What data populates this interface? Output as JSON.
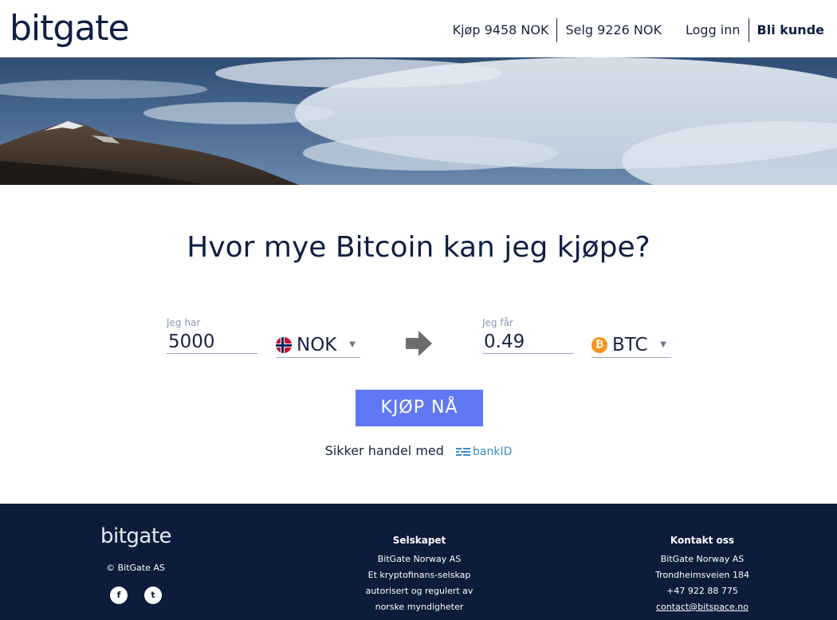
{
  "header": {
    "logo": "bitgate",
    "buy_price": "Kjøp 9458 NOK",
    "sell_price": "Selg 9226 NOK",
    "login": "Logg inn",
    "signup": "Bli kunde"
  },
  "main": {
    "title": "Hvor mye Bitcoin kan jeg kjøpe?",
    "have": {
      "label": "Jeg har",
      "value": "5000",
      "currency": "NOK"
    },
    "get": {
      "label": "Jeg får",
      "value": "0.49",
      "currency": "BTC"
    },
    "buy_button": "KJØP NÅ",
    "secure_text": "Sikker handel med",
    "bankid": "bankID"
  },
  "footer": {
    "logo": "bitgate",
    "copyright": "© BitGate AS",
    "company": {
      "heading": "Selskapet",
      "lines": [
        "BitGate Norway AS",
        "Et kryptofinans-selskap",
        "autorisert og regulert av",
        "norske myndigheter"
      ]
    },
    "contact": {
      "heading": "Kontakt oss",
      "lines": [
        "BitGate Norway AS",
        "Trondheimsveien 184",
        "+47 922 88 775"
      ],
      "email": "contact@bitspace.no"
    }
  },
  "colors": {
    "navy": "#0c1c3a",
    "accent": "#6178f5",
    "bitcoin": "#f7931a"
  },
  "icons": [
    "norway-flag-icon",
    "bitcoin-icon",
    "arrow-right-icon",
    "bankid-icon",
    "facebook-icon",
    "twitter-icon",
    "caret-down-icon"
  ]
}
